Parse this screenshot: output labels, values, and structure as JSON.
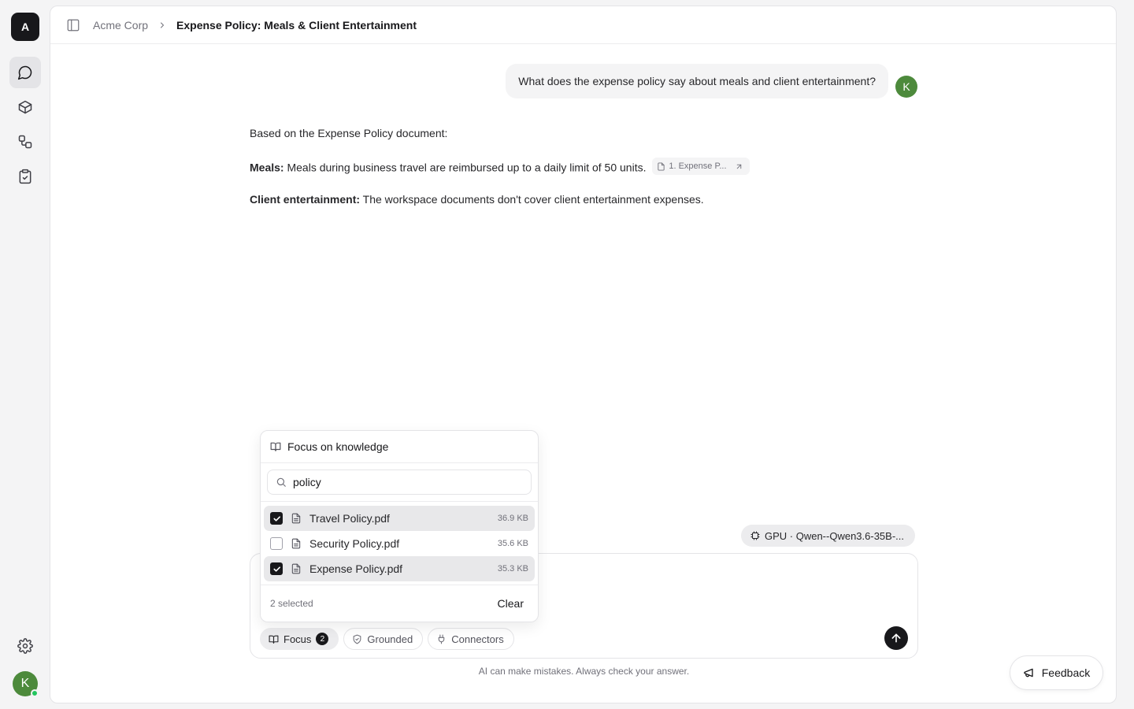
{
  "app": {
    "logo_letter": "A"
  },
  "rail": {
    "items": [
      {
        "name": "chat",
        "active": true
      },
      {
        "name": "knowledge"
      },
      {
        "name": "workflows"
      },
      {
        "name": "tasks"
      }
    ],
    "user_initial": "K"
  },
  "breadcrumb": {
    "parent": "Acme Corp",
    "current": "Expense Policy: Meals & Client Entertainment"
  },
  "conversation": {
    "user_message": "What does the expense policy say about meals and client entertainment?",
    "user_initial": "K",
    "answer": {
      "intro": "Based on the Expense Policy document:",
      "meals_label": "Meals:",
      "meals_text": "Meals during business travel are reimbursed up to a daily limit of 50 units.",
      "citation": "1. Expense P...",
      "client_label": "Client entertainment:",
      "client_text": "The workspace documents don't cover client entertainment expenses."
    }
  },
  "model_pill": {
    "label": "GPU · Qwen--Qwen3.6-35B-..."
  },
  "focus_popover": {
    "title": "Focus on knowledge",
    "search_value": "policy",
    "files": [
      {
        "name": "Travel Policy.pdf",
        "size": "36.9 KB",
        "checked": true
      },
      {
        "name": "Security Policy.pdf",
        "size": "35.6 KB",
        "checked": false
      },
      {
        "name": "Expense Policy.pdf",
        "size": "35.3 KB",
        "checked": true
      }
    ],
    "selected_count": "2 selected",
    "clear_label": "Clear"
  },
  "composer": {
    "focus_label": "Focus",
    "focus_count": "2",
    "grounded_label": "Grounded",
    "connectors_label": "Connectors"
  },
  "disclaimer": "AI can make mistakes. Always check your answer.",
  "feedback_label": "Feedback",
  "colors": {
    "accent": "#18181b",
    "avatar": "#4d8a3c",
    "online": "#22c55e"
  }
}
